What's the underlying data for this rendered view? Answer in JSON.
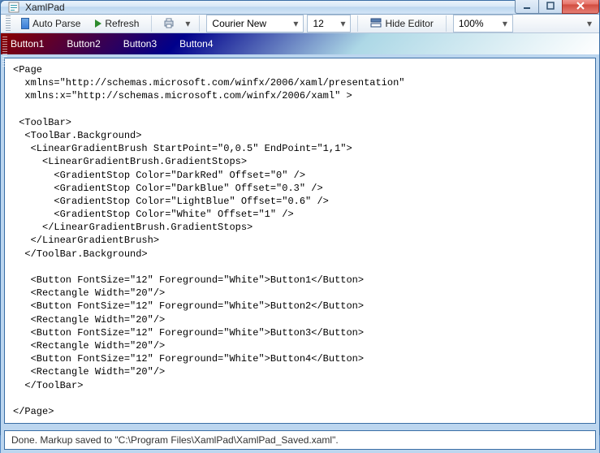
{
  "window": {
    "title": "XamlPad"
  },
  "toolbar": {
    "autoParse": "Auto Parse",
    "refresh": "Refresh",
    "font": "Courier New",
    "fontSize": "12",
    "hideEditor": "Hide Editor",
    "zoom": "100%"
  },
  "preview": {
    "buttons": [
      "Button1",
      "Button2",
      "Button3",
      "Button4"
    ]
  },
  "editor": {
    "content": "<Page\n  xmlns=\"http://schemas.microsoft.com/winfx/2006/xaml/presentation\"\n  xmlns:x=\"http://schemas.microsoft.com/winfx/2006/xaml\" >\n\n <ToolBar>\n  <ToolBar.Background>\n   <LinearGradientBrush StartPoint=\"0,0.5\" EndPoint=\"1,1\">\n     <LinearGradientBrush.GradientStops>\n       <GradientStop Color=\"DarkRed\" Offset=\"0\" />\n       <GradientStop Color=\"DarkBlue\" Offset=\"0.3\" />\n       <GradientStop Color=\"LightBlue\" Offset=\"0.6\" />\n       <GradientStop Color=\"White\" Offset=\"1\" />\n     </LinearGradientBrush.GradientStops>\n   </LinearGradientBrush>\n  </ToolBar.Background>\n\n   <Button FontSize=\"12\" Foreground=\"White\">Button1</Button>\n   <Rectangle Width=\"20\"/>\n   <Button FontSize=\"12\" Foreground=\"White\">Button2</Button>\n   <Rectangle Width=\"20\"/>\n   <Button FontSize=\"12\" Foreground=\"White\">Button3</Button>\n   <Rectangle Width=\"20\"/>\n   <Button FontSize=\"12\" Foreground=\"White\">Button4</Button>\n   <Rectangle Width=\"20\"/>\n  </ToolBar>\n\n</Page>"
  },
  "status": {
    "text": "Done. Markup saved to \"C:\\Program Files\\XamlPad\\XamlPad_Saved.xaml\"."
  }
}
